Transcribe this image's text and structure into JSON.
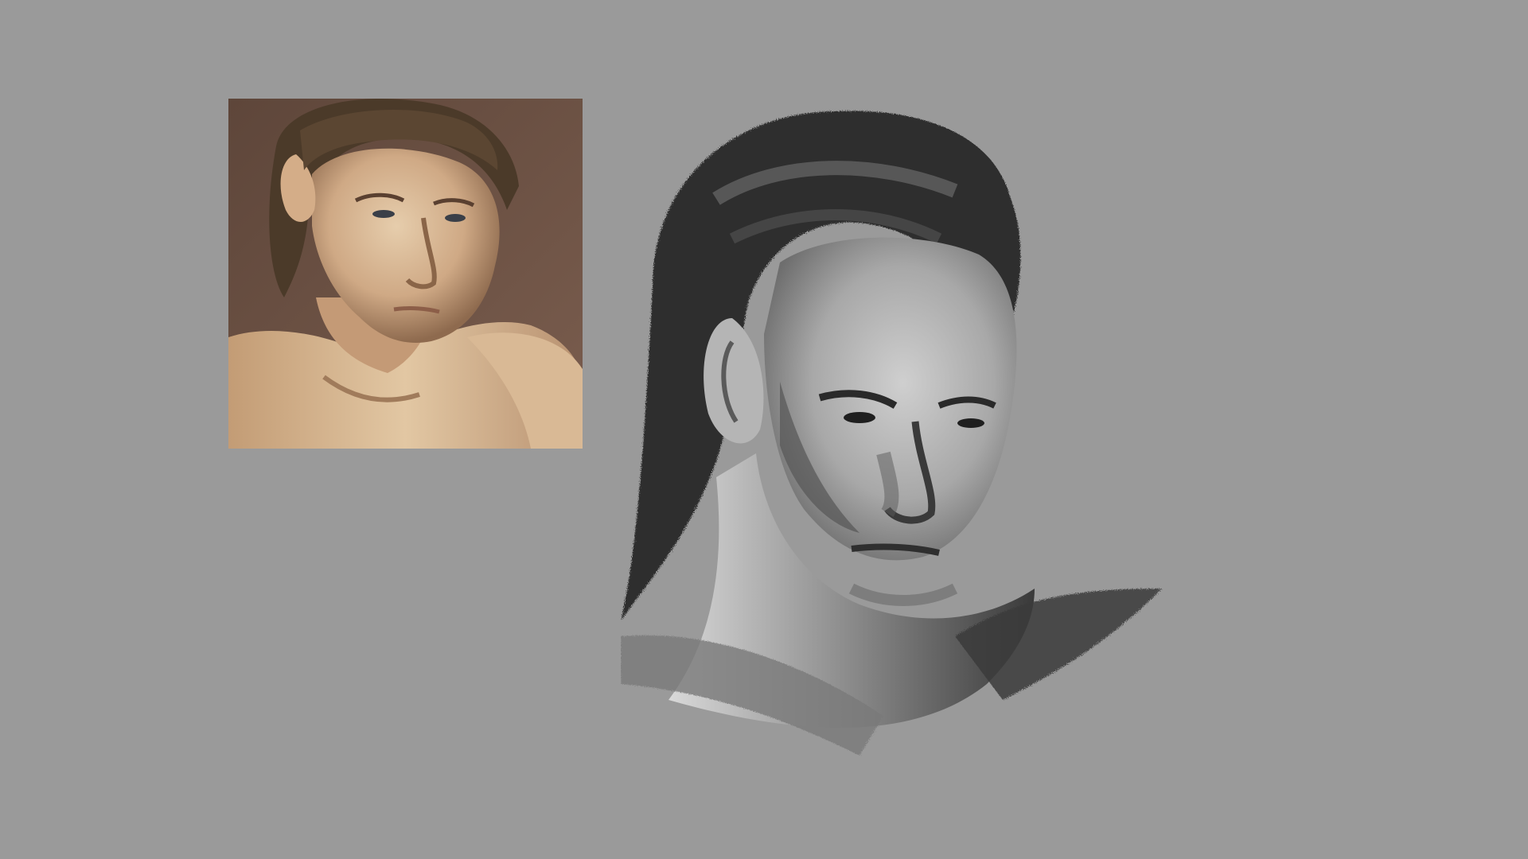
{
  "canvas": {
    "background_color": "#9a9a9a"
  },
  "reference_photo": {
    "kind": "color photograph of a long-haired man looking down over his shoulder",
    "colors": {
      "background": "#6e5446",
      "skin_light": "#e2c7a3",
      "skin_mid": "#c9a27b",
      "skin_shadow": "#8f6a4d",
      "hair": "#4a3a2a"
    }
  },
  "grayscale_study": {
    "kind": "digital grayscale painted portrait study of the same head",
    "colors": {
      "highlight": "#d8d8d8",
      "midtone": "#9b9b9b",
      "shadow": "#3a3a3a",
      "darkest": "#1f1f1f"
    }
  }
}
